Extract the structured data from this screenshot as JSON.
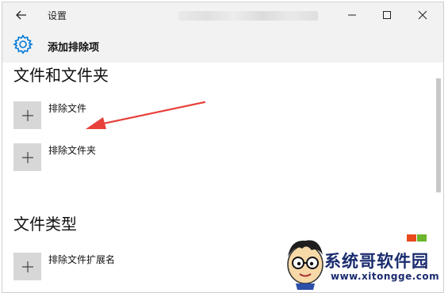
{
  "titlebar": {
    "title": "设置"
  },
  "header": {
    "title": "添加排除项"
  },
  "sections": [
    {
      "title": "文件和文件夹",
      "items": [
        {
          "label": "排除文件"
        },
        {
          "label": "排除文件夹"
        }
      ]
    },
    {
      "title": "文件类型",
      "items": [
        {
          "label": "排除文件扩展名"
        }
      ]
    }
  ],
  "watermark": {
    "name": "系统哥软件园",
    "url": "www.xitongge.com"
  },
  "colors": {
    "accent": "#0078d7",
    "annotation_arrow": "#e8403a",
    "watermark": "#1a2b6e"
  }
}
